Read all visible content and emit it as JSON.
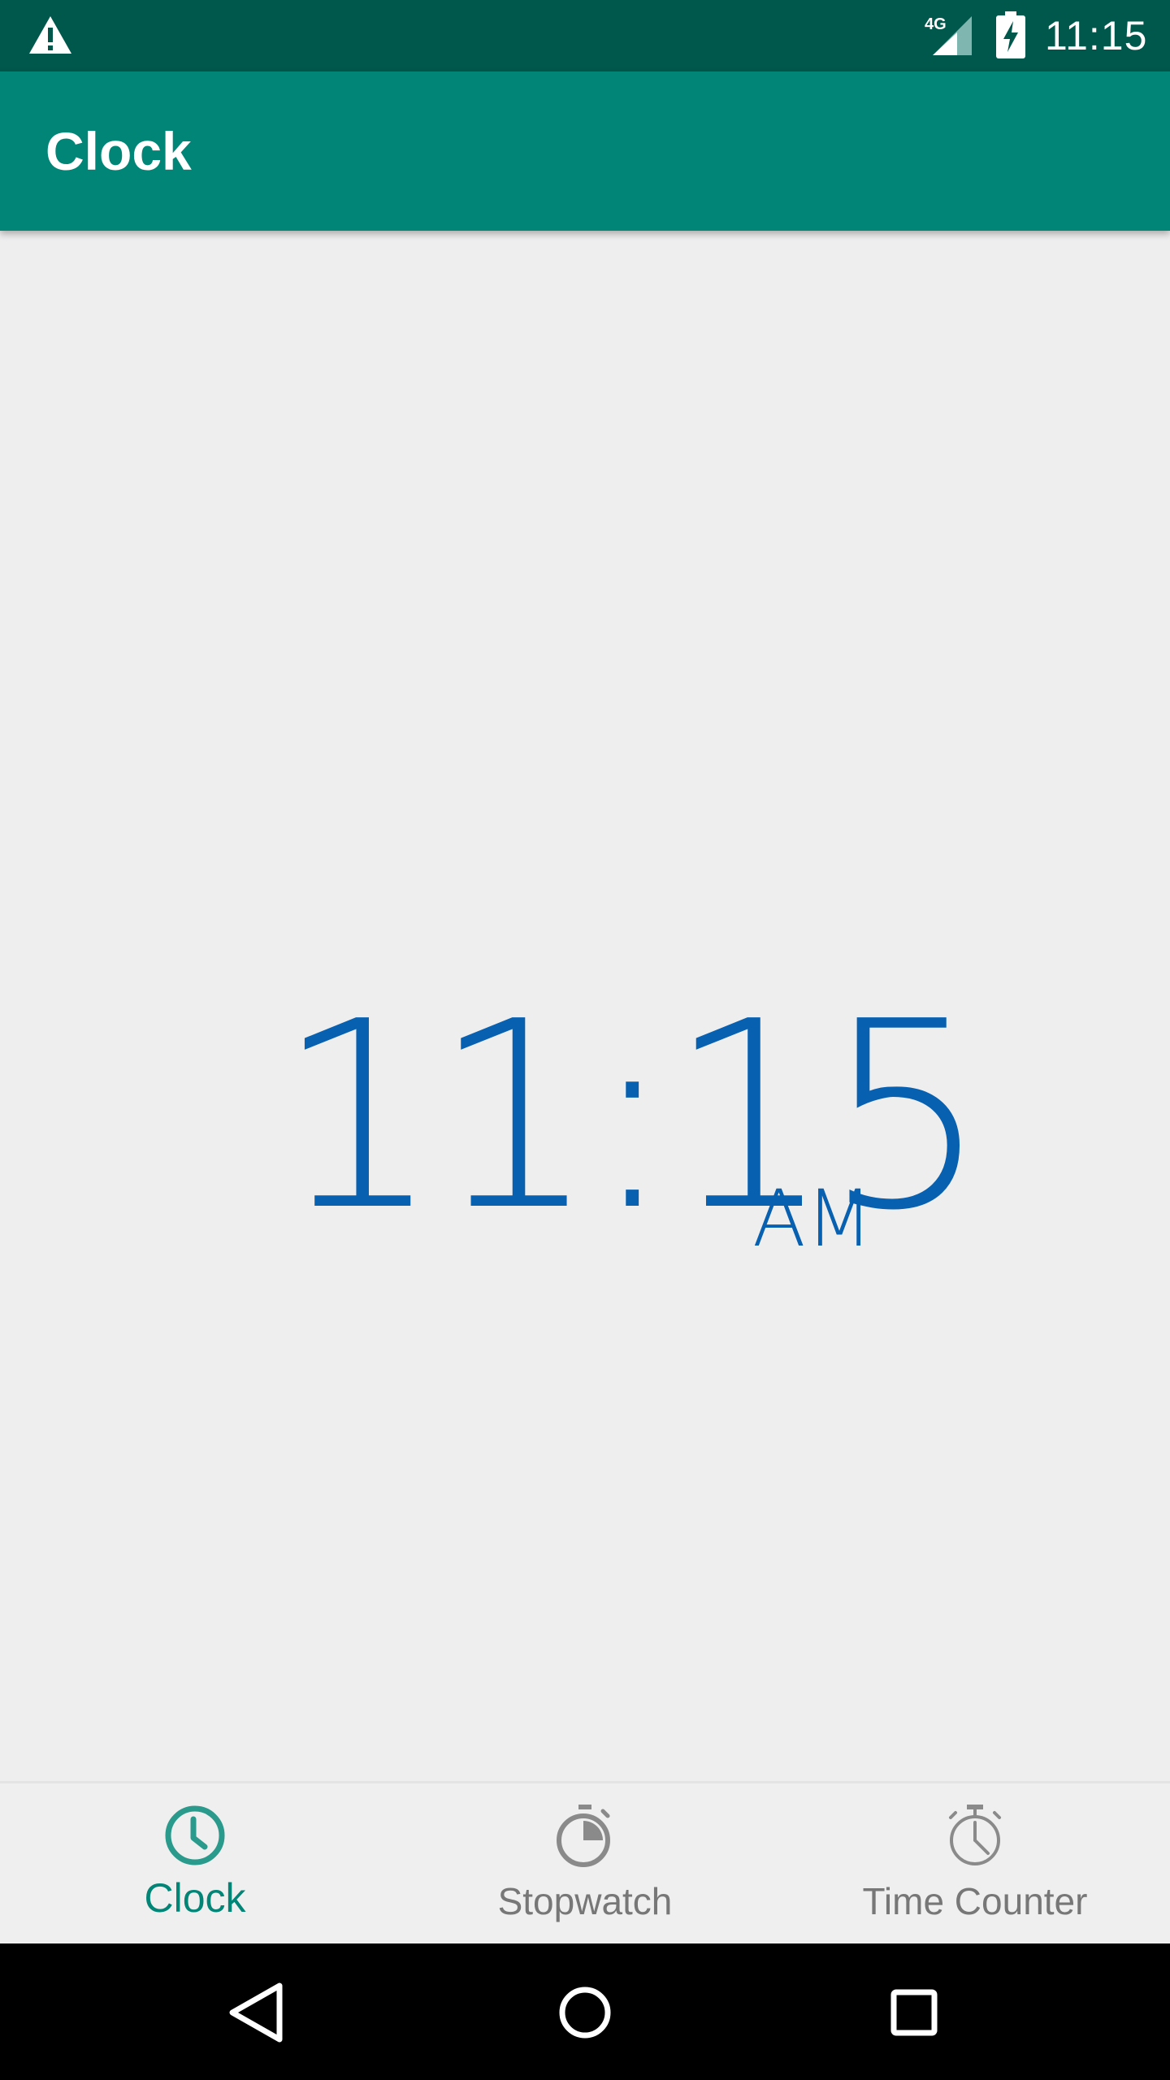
{
  "status_bar": {
    "time": "11:15",
    "network_label": "4G",
    "icons": [
      "warning-icon",
      "signal-icon",
      "battery-charging-icon"
    ]
  },
  "app_bar": {
    "title": "Clock"
  },
  "clock": {
    "time": "11:15",
    "ampm": "AM"
  },
  "bottom_nav": {
    "items": [
      {
        "label": "Clock",
        "icon": "clock-icon",
        "active": true
      },
      {
        "label": "Stopwatch",
        "icon": "stopwatch-icon",
        "active": false
      },
      {
        "label": "Time Counter",
        "icon": "timer-icon",
        "active": false
      }
    ]
  },
  "colors": {
    "primary_dark": "#00574b",
    "primary": "#008577",
    "clock_text": "#0860b0",
    "background": "#eeeeef"
  },
  "system_nav": {
    "icons": [
      "back-icon",
      "home-icon",
      "recents-icon"
    ]
  }
}
